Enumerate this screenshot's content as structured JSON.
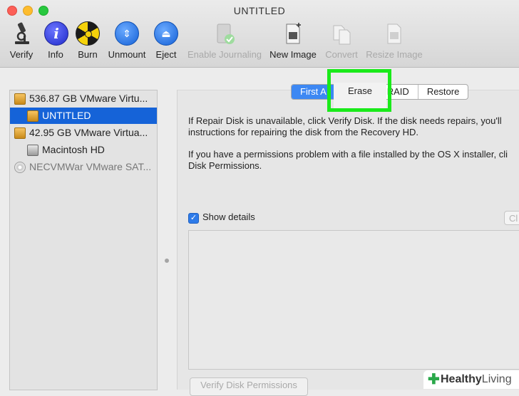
{
  "window": {
    "title": "UNTITLED"
  },
  "toolbar": {
    "verify": "Verify",
    "info": "Info",
    "burn": "Burn",
    "unmount": "Unmount",
    "eject": "Eject",
    "enable_journaling": "Enable Journaling",
    "new_image": "New Image",
    "convert": "Convert",
    "resize_image": "Resize Image"
  },
  "sidebar": {
    "items": [
      {
        "label": "536.87 GB VMware Virtu...",
        "icon": "gold-drive-icon"
      },
      {
        "label": "UNTITLED",
        "icon": "gold-volume-icon",
        "selected": true
      },
      {
        "label": "42.95 GB VMware Virtua...",
        "icon": "gold-drive-icon"
      },
      {
        "label": "Macintosh HD",
        "icon": "gray-volume-icon"
      },
      {
        "label": "NECVMWar VMware SAT...",
        "icon": "optical-disc-icon"
      }
    ]
  },
  "tabs": {
    "first_aid": "First A",
    "erase": "Erase",
    "raid": "RAID",
    "restore": "Restore"
  },
  "main": {
    "para1_line1": "If Repair Disk is unavailable, click Verify Disk. If the disk needs repairs, you'll",
    "para1_line2": "instructions for repairing the disk from the Recovery HD.",
    "para2_line1": "If you have a permissions problem with a file installed by the OS X installer, cli",
    "para2_line2": "Disk Permissions.",
    "show_details": "Show details",
    "clear_history": "Cl",
    "verify_permissions": "Verify Disk Permissions"
  },
  "watermark": {
    "part1": "Healthy",
    "part2": "Living"
  },
  "colors": {
    "selection": "#1563d8",
    "highlight_box": "#1aea1a",
    "active_tab": "#3d88f3"
  }
}
